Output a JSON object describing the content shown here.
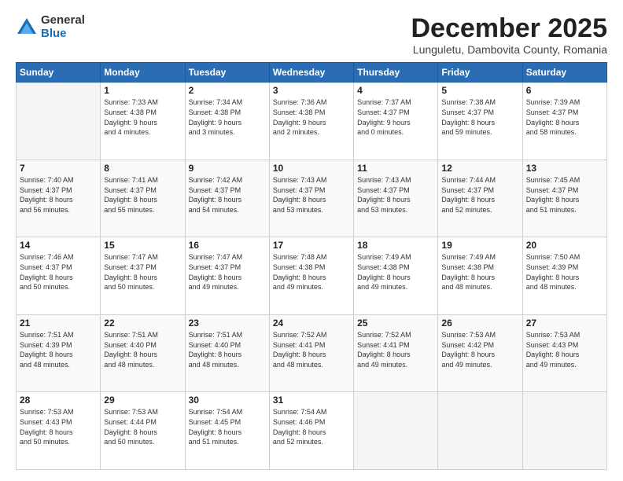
{
  "logo": {
    "general": "General",
    "blue": "Blue"
  },
  "title": {
    "month": "December 2025",
    "location": "Lunguletu, Dambovita County, Romania"
  },
  "days_header": [
    "Sunday",
    "Monday",
    "Tuesday",
    "Wednesday",
    "Thursday",
    "Friday",
    "Saturday"
  ],
  "weeks": [
    [
      {
        "day": "",
        "text": ""
      },
      {
        "day": "1",
        "text": "Sunrise: 7:33 AM\nSunset: 4:38 PM\nDaylight: 9 hours\nand 4 minutes."
      },
      {
        "day": "2",
        "text": "Sunrise: 7:34 AM\nSunset: 4:38 PM\nDaylight: 9 hours\nand 3 minutes."
      },
      {
        "day": "3",
        "text": "Sunrise: 7:36 AM\nSunset: 4:38 PM\nDaylight: 9 hours\nand 2 minutes."
      },
      {
        "day": "4",
        "text": "Sunrise: 7:37 AM\nSunset: 4:37 PM\nDaylight: 9 hours\nand 0 minutes."
      },
      {
        "day": "5",
        "text": "Sunrise: 7:38 AM\nSunset: 4:37 PM\nDaylight: 8 hours\nand 59 minutes."
      },
      {
        "day": "6",
        "text": "Sunrise: 7:39 AM\nSunset: 4:37 PM\nDaylight: 8 hours\nand 58 minutes."
      }
    ],
    [
      {
        "day": "7",
        "text": "Sunrise: 7:40 AM\nSunset: 4:37 PM\nDaylight: 8 hours\nand 56 minutes."
      },
      {
        "day": "8",
        "text": "Sunrise: 7:41 AM\nSunset: 4:37 PM\nDaylight: 8 hours\nand 55 minutes."
      },
      {
        "day": "9",
        "text": "Sunrise: 7:42 AM\nSunset: 4:37 PM\nDaylight: 8 hours\nand 54 minutes."
      },
      {
        "day": "10",
        "text": "Sunrise: 7:43 AM\nSunset: 4:37 PM\nDaylight: 8 hours\nand 53 minutes."
      },
      {
        "day": "11",
        "text": "Sunrise: 7:43 AM\nSunset: 4:37 PM\nDaylight: 8 hours\nand 53 minutes."
      },
      {
        "day": "12",
        "text": "Sunrise: 7:44 AM\nSunset: 4:37 PM\nDaylight: 8 hours\nand 52 minutes."
      },
      {
        "day": "13",
        "text": "Sunrise: 7:45 AM\nSunset: 4:37 PM\nDaylight: 8 hours\nand 51 minutes."
      }
    ],
    [
      {
        "day": "14",
        "text": "Sunrise: 7:46 AM\nSunset: 4:37 PM\nDaylight: 8 hours\nand 50 minutes."
      },
      {
        "day": "15",
        "text": "Sunrise: 7:47 AM\nSunset: 4:37 PM\nDaylight: 8 hours\nand 50 minutes."
      },
      {
        "day": "16",
        "text": "Sunrise: 7:47 AM\nSunset: 4:37 PM\nDaylight: 8 hours\nand 49 minutes."
      },
      {
        "day": "17",
        "text": "Sunrise: 7:48 AM\nSunset: 4:38 PM\nDaylight: 8 hours\nand 49 minutes."
      },
      {
        "day": "18",
        "text": "Sunrise: 7:49 AM\nSunset: 4:38 PM\nDaylight: 8 hours\nand 49 minutes."
      },
      {
        "day": "19",
        "text": "Sunrise: 7:49 AM\nSunset: 4:38 PM\nDaylight: 8 hours\nand 48 minutes."
      },
      {
        "day": "20",
        "text": "Sunrise: 7:50 AM\nSunset: 4:39 PM\nDaylight: 8 hours\nand 48 minutes."
      }
    ],
    [
      {
        "day": "21",
        "text": "Sunrise: 7:51 AM\nSunset: 4:39 PM\nDaylight: 8 hours\nand 48 minutes."
      },
      {
        "day": "22",
        "text": "Sunrise: 7:51 AM\nSunset: 4:40 PM\nDaylight: 8 hours\nand 48 minutes."
      },
      {
        "day": "23",
        "text": "Sunrise: 7:51 AM\nSunset: 4:40 PM\nDaylight: 8 hours\nand 48 minutes."
      },
      {
        "day": "24",
        "text": "Sunrise: 7:52 AM\nSunset: 4:41 PM\nDaylight: 8 hours\nand 48 minutes."
      },
      {
        "day": "25",
        "text": "Sunrise: 7:52 AM\nSunset: 4:41 PM\nDaylight: 8 hours\nand 49 minutes."
      },
      {
        "day": "26",
        "text": "Sunrise: 7:53 AM\nSunset: 4:42 PM\nDaylight: 8 hours\nand 49 minutes."
      },
      {
        "day": "27",
        "text": "Sunrise: 7:53 AM\nSunset: 4:43 PM\nDaylight: 8 hours\nand 49 minutes."
      }
    ],
    [
      {
        "day": "28",
        "text": "Sunrise: 7:53 AM\nSunset: 4:43 PM\nDaylight: 8 hours\nand 50 minutes."
      },
      {
        "day": "29",
        "text": "Sunrise: 7:53 AM\nSunset: 4:44 PM\nDaylight: 8 hours\nand 50 minutes."
      },
      {
        "day": "30",
        "text": "Sunrise: 7:54 AM\nSunset: 4:45 PM\nDaylight: 8 hours\nand 51 minutes."
      },
      {
        "day": "31",
        "text": "Sunrise: 7:54 AM\nSunset: 4:46 PM\nDaylight: 8 hours\nand 52 minutes."
      },
      {
        "day": "",
        "text": ""
      },
      {
        "day": "",
        "text": ""
      },
      {
        "day": "",
        "text": ""
      }
    ]
  ]
}
